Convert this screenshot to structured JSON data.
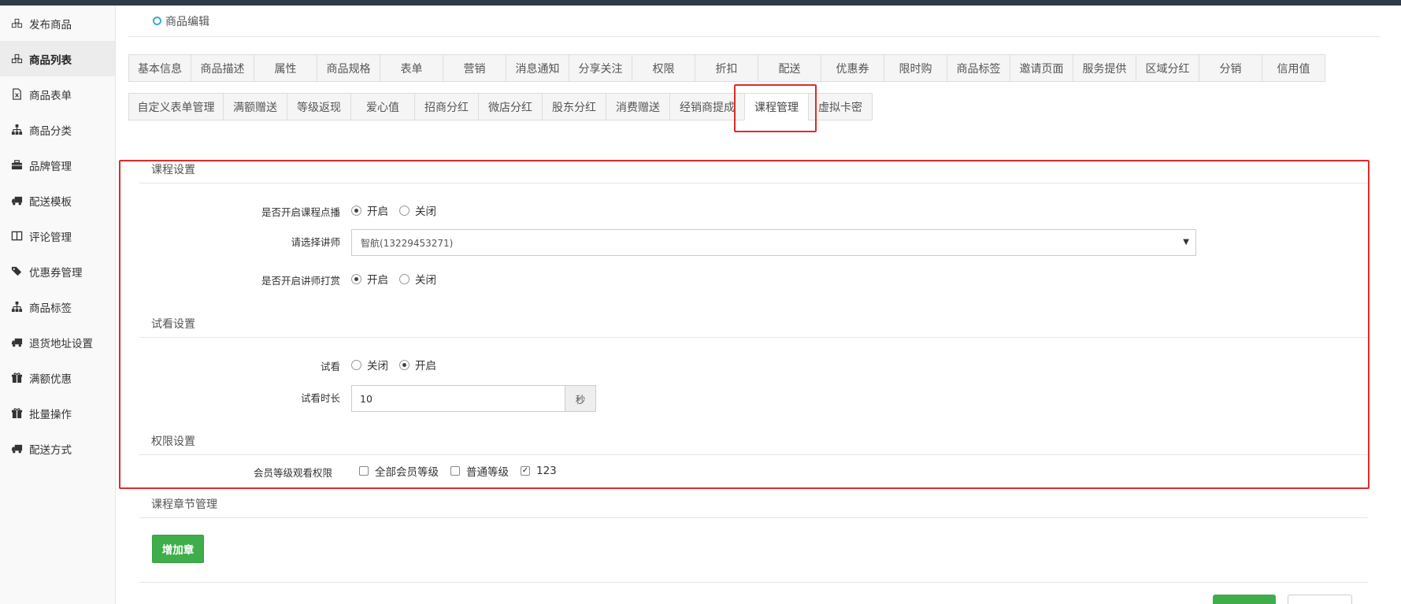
{
  "sidebar": {
    "items": [
      {
        "label": "发布商品",
        "icon": "cubes-icon"
      },
      {
        "label": "商品列表",
        "icon": "cubes-icon",
        "active": true
      },
      {
        "label": "商品表单",
        "icon": "excel-file-icon"
      },
      {
        "label": "商品分类",
        "icon": "sitemap-icon"
      },
      {
        "label": "品牌管理",
        "icon": "briefcase-icon"
      },
      {
        "label": "配送模板",
        "icon": "truck-icon"
      },
      {
        "label": "评论管理",
        "icon": "columns-icon"
      },
      {
        "label": "优惠券管理",
        "icon": "tags-icon"
      },
      {
        "label": "商品标签",
        "icon": "sitemap-icon"
      },
      {
        "label": "退货地址设置",
        "icon": "truck-icon"
      },
      {
        "label": "满额优惠",
        "icon": "gift-icon"
      },
      {
        "label": "批量操作",
        "icon": "gift-icon"
      },
      {
        "label": "配送方式",
        "icon": "truck-icon"
      }
    ]
  },
  "header": {
    "title": "商品编辑"
  },
  "tabs_row1": [
    "基本信息",
    "商品描述",
    "属性",
    "商品规格",
    "表单",
    "营销",
    "消息通知",
    "分享关注",
    "权限",
    "折扣",
    "配送",
    "优惠券",
    "限时购",
    "商品标签",
    "邀请页面",
    "服务提供",
    "区域分红",
    "分销",
    "信用值"
  ],
  "tabs_row2": [
    "自定义表单管理",
    "满额赠送",
    "等级返现",
    "爱心值",
    "招商分红",
    "微店分红",
    "股东分红",
    "消费赠送",
    "经销商提成",
    "课程管理",
    "虚拟卡密"
  ],
  "active_tab": "课程管理",
  "course": {
    "section_title": "课程设置",
    "vod_label": "是否开启课程点播",
    "vod_options": [
      "开启",
      "关闭"
    ],
    "vod_selected": "开启",
    "lecturer_label": "请选择讲师",
    "lecturer_value": "智航(13229453271)",
    "reward_label": "是否开启讲师打赏",
    "reward_options": [
      "开启",
      "关闭"
    ],
    "reward_selected": "开启"
  },
  "trial": {
    "section_title": "试看设置",
    "trial_label": "试看",
    "trial_options": [
      "关闭",
      "开启"
    ],
    "trial_selected": "开启",
    "duration_label": "试看时长",
    "duration_value": "10",
    "duration_unit": "秒"
  },
  "permission": {
    "section_title": "权限设置",
    "level_label": "会员等级观看权限",
    "levels": [
      {
        "label": "全部会员等级",
        "checked": false
      },
      {
        "label": "普通等级",
        "checked": false
      },
      {
        "label": "123",
        "checked": true
      }
    ]
  },
  "chapters": {
    "section_title": "课程章节管理",
    "add_button": "增加章"
  },
  "colors": {
    "accent_green": "#3fae4a",
    "highlight_red": "#e02a2a",
    "ring_blue": "#3fa9c9"
  }
}
